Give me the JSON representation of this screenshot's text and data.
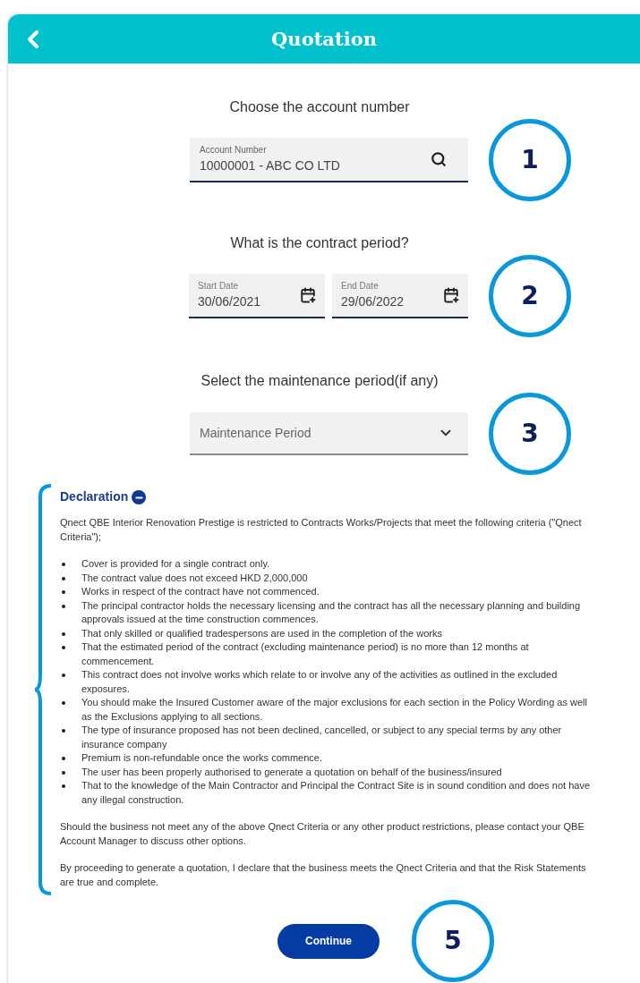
{
  "header": {
    "title": "Quotation"
  },
  "account": {
    "prompt": "Choose the account number",
    "label": "Account Number",
    "value": "10000001 - ABC CO LTD",
    "marker": "1"
  },
  "contract_period": {
    "prompt": "What is the contract period?",
    "fields": [
      {
        "label": "Start Date",
        "value": "30/06/2021"
      },
      {
        "label": "End Date",
        "value": "29/06/2022"
      }
    ],
    "marker": "2"
  },
  "maintenance": {
    "prompt": "Select the maintenance period(if any)",
    "placeholder": "Maintenance Period",
    "marker": "3"
  },
  "declaration": {
    "title": "Declaration",
    "expanded": true,
    "intro": "Qnect QBE Interior Renovation Prestige is restricted to Contracts Works/Projects that meet the following criteria (\"Qnect Criteria\");",
    "criteria": [
      "Cover is provided for a single contract only.",
      "The contract value does not exceed HKD 2,000,000",
      "Works in respect of the contract have not commenced.",
      "The principal contractor holds the necessary licensing and the contract has all the necessary planning and building approvals issued at the time construction commences.",
      "That only skilled or qualified tradespersons are used in the completion of the works",
      "That the estimated period of the contract (excluding maintenance period) is no more than 12 months at commencement.",
      "This contract does not involve works which relate to or involve any of the activities as outlined in the excluded exposures.",
      "You should make the Insured Customer aware of the major exclusions for each section in the Policy Wording as well as the Exclusions applying to all sections.",
      "The type of insurance proposed has not been declined, cancelled, or subject to any special terms by any other insurance company",
      "Premium is non-refundable once the works commence.",
      "The user has been properly authorised to generate a quotation on behalf of the business/insured",
      "That to the knowledge of the Main Contractor and Principal the Contract Site is in sound condition and does not have any illegal construction."
    ],
    "paragraphs": [
      "Should the business not meet any of the above Qnect Criteria or any other product restrictions, please contact your QBE Account Manager to discuss other options.",
      "By proceeding to generate a quotation, I declare that the business meets the Qnect Criteria and that the Risk Statements are true and complete."
    ]
  },
  "footer": {
    "button": "Continue",
    "marker": "5"
  }
}
